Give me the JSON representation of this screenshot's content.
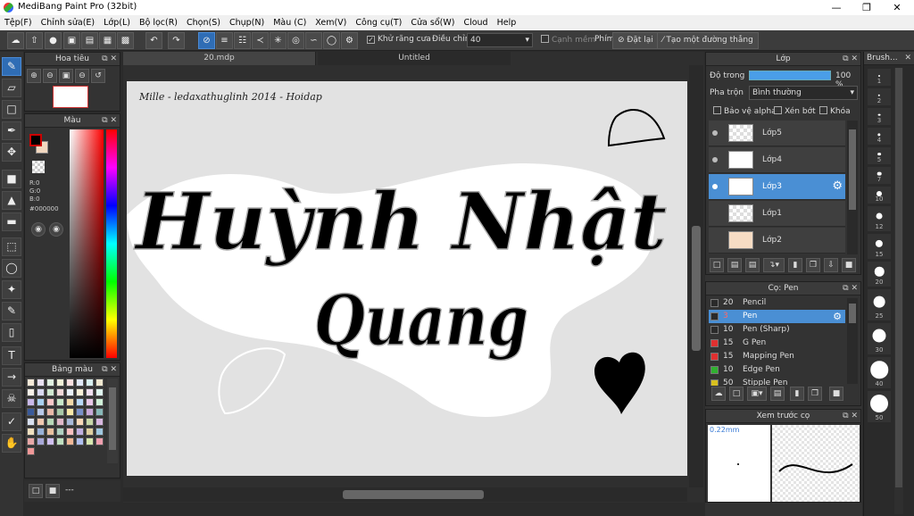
{
  "app": {
    "title": "MediBang Paint Pro (32bit)"
  },
  "menu": [
    "Tệp(F)",
    "Chỉnh sửa(E)",
    "Lớp(L)",
    "Bộ lọc(R)",
    "Chọn(S)",
    "Chụp(N)",
    "Màu (C)",
    "Xem(V)",
    "Công cụ(T)",
    "Cửa sổ(W)",
    "Cloud",
    "Help"
  ],
  "toolbar": {
    "antialias_label": "Khử răng cưa",
    "adjust_label": "Điều chỉnh",
    "adjust_value": "40",
    "smooth_label": "Cạnh mềm",
    "key_label": "Phím",
    "set_label": "Đặt lại",
    "straight_label": "Tạo một đường thẳng"
  },
  "tabs": [
    "20.mdp",
    "Untitled"
  ],
  "navigator": {
    "title": "Hoa tiêu"
  },
  "color": {
    "title": "Màu",
    "r": "R:0",
    "g": "G:0",
    "b": "B:0",
    "hex": "#000000"
  },
  "palette": {
    "title": "Bảng màu",
    "footer": "---",
    "colors": [
      "#f4e9d8",
      "#e8e0f0",
      "#e0f0e0",
      "#f0f0d8",
      "#f8e0e0",
      "#e0e8f8",
      "#d8f0f0",
      "#f0e8d0",
      "#f6f0e8",
      "#d8d8f0",
      "#d0e8d0",
      "#f0d8d8",
      "#e8f0f8",
      "#f8f0d8",
      "#f0e0f0",
      "#e0f8f0",
      "#c8b8e8",
      "#a8d0f0",
      "#f8c8c8",
      "#c8e8c8",
      "#f0d8a8",
      "#b8d8f8",
      "#e8c8e8",
      "#d0f0d8",
      "#3a5a9a",
      "#b8c8e8",
      "#e8b8a8",
      "#a8c8a8",
      "#f8e8a8",
      "#7890c8",
      "#c8a8d8",
      "#88b8b8",
      "#d8e0f0",
      "#f0c8b0",
      "#b8d8b8",
      "#e0b8c8",
      "#a8b8d8",
      "#f8d8b8",
      "#c8d8a8",
      "#d8b8e0",
      "#f0e0c0",
      "#98b0d8",
      "#e8c0a0",
      "#b0d0c0",
      "#f8c0c0",
      "#c0b0e0",
      "#e0d0a0",
      "#a0c8e0",
      "#e8a8a8",
      "#a8a8d8",
      "#d0c0f0",
      "#c0e0c0",
      "#f0b898",
      "#b0c0f0",
      "#d8e8b0",
      "#f0a0b0",
      "#f09898"
    ]
  },
  "layers": {
    "title": "Lớp",
    "opacity_label": "Độ trong",
    "opacity_value": "100 %",
    "blend_label": "Pha trộn",
    "blend_value": "Bình thường",
    "protect_alpha": "Bảo vệ alpha",
    "clipping": "Xén bớt",
    "lock": "Khóa",
    "items": [
      "Lớp5",
      "Lớp4",
      "Lớp3",
      "Lớp1",
      "Lớp2"
    ]
  },
  "brushes": {
    "title": "Cọ: Pen",
    "items": [
      {
        "size": "20",
        "name": "Pencil",
        "color": "#2a2a2a"
      },
      {
        "size": "3",
        "name": "Pen",
        "color": "#2a2a2a"
      },
      {
        "size": "10",
        "name": "Pen (Sharp)",
        "color": "#2a2a2a"
      },
      {
        "size": "15",
        "name": "G Pen",
        "color": "#e03030"
      },
      {
        "size": "15",
        "name": "Mapping Pen",
        "color": "#e03030"
      },
      {
        "size": "10",
        "name": "Edge Pen",
        "color": "#30b030"
      },
      {
        "size": "50",
        "name": "Stipple Pen",
        "color": "#d8c020"
      }
    ]
  },
  "preview": {
    "title": "Xem trước cọ",
    "size": "0.22mm"
  },
  "brushsize": {
    "title": "Brush...",
    "sizes": [
      "1",
      "2",
      "3",
      "4",
      "5",
      "7",
      "10",
      "12",
      "15",
      "20",
      "25",
      "30",
      "40",
      "50"
    ]
  },
  "artwork": {
    "caption": "Mille - ledaxathuglinh 2014 - Hoidap",
    "name1": "Huỳnh Nhật",
    "name2": "Quang"
  }
}
